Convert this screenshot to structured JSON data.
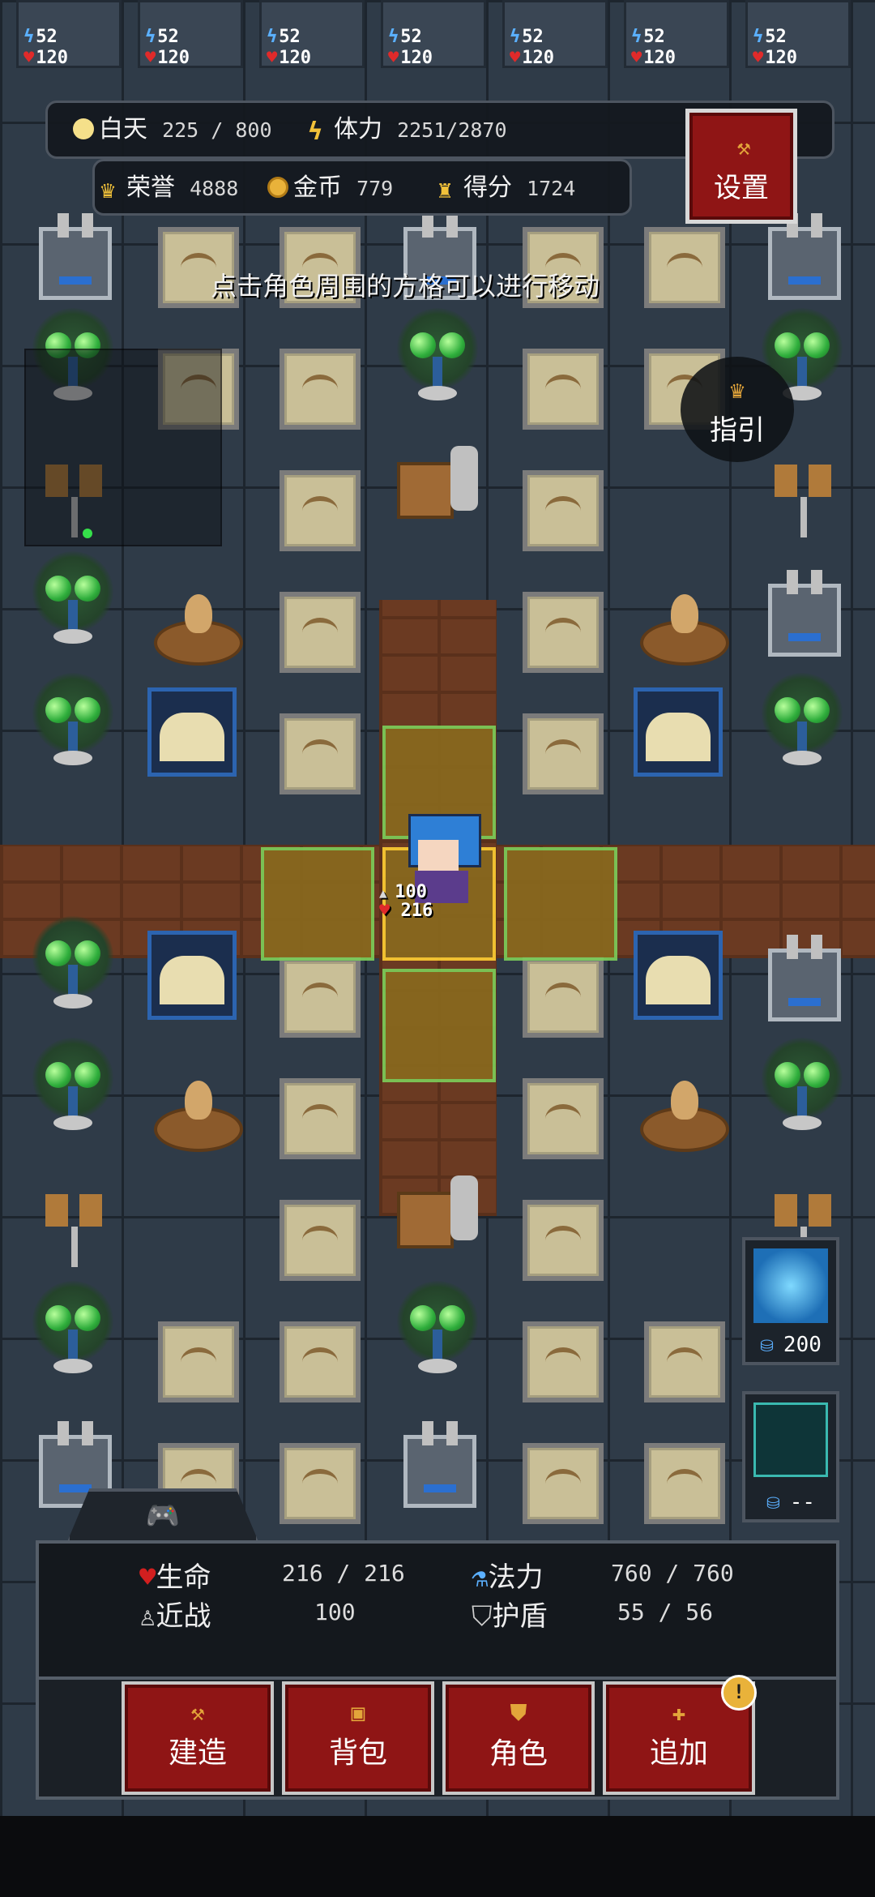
{
  "top_units": [
    {
      "mp": "52",
      "hp": "120"
    },
    {
      "mp": "52",
      "hp": "120"
    },
    {
      "mp": "52",
      "hp": "120"
    },
    {
      "mp": "52",
      "hp": "120"
    },
    {
      "mp": "52",
      "hp": "120"
    },
    {
      "mp": "52",
      "hp": "120"
    },
    {
      "mp": "52",
      "hp": "120"
    }
  ],
  "hud": {
    "day_label": "白天",
    "day_value": "225 / 800",
    "stamina_label": "体力",
    "stamina_value": "2251/2870",
    "honor_label": "荣誉",
    "honor_value": "4888",
    "gold_label": "金币",
    "gold_value": "779",
    "score_label": "得分",
    "score_value": "1724"
  },
  "settings_label": "设置",
  "hint_text": "点击角色周围的方格可以进行移动",
  "guide_label": "指引",
  "player": {
    "attack": "100",
    "hp": "216"
  },
  "skills": [
    {
      "icon": "lightning-skill-icon",
      "cost": "200"
    },
    {
      "icon": "shield-skill-icon",
      "cost": "--"
    }
  ],
  "stats": {
    "hp_label": "生命",
    "hp_value": "216 / 216",
    "mp_label": "法力",
    "mp_value": "760 / 760",
    "melee_label": "近战",
    "melee_value": "100",
    "shield_label": "护盾",
    "shield_value": "55  /  56"
  },
  "tabs": [
    {
      "label": "建造",
      "icon": "hammer-icon"
    },
    {
      "label": "背包",
      "icon": "bag-icon"
    },
    {
      "label": "角色",
      "icon": "character-icon"
    },
    {
      "label": "追加",
      "icon": "plus-icon"
    }
  ],
  "badge": "!",
  "colors": {
    "button_red": "#8f1515",
    "move_highlight": "#7ccf5a",
    "selected": "#ffcf33"
  }
}
